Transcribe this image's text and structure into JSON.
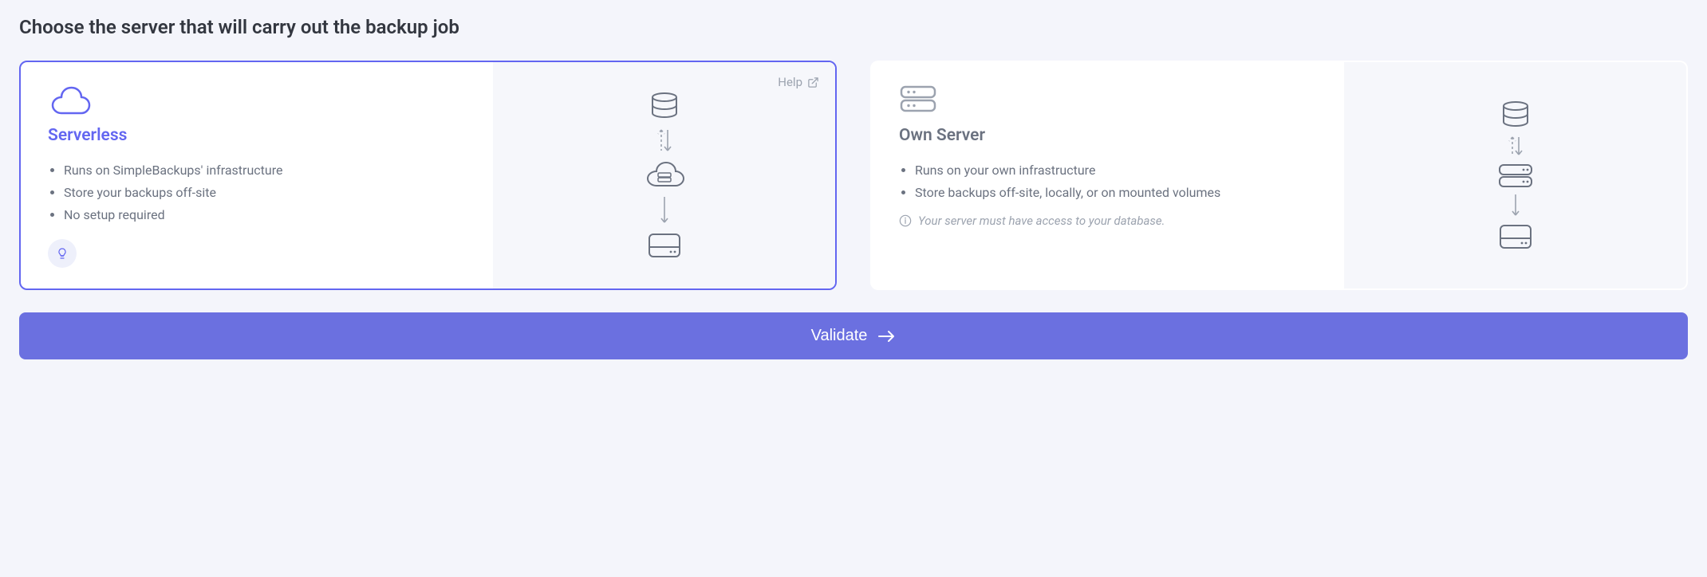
{
  "page": {
    "title": "Choose the server that will carry out the backup job"
  },
  "options": {
    "serverless": {
      "title": "Serverless",
      "features": [
        "Runs on SimpleBackups' infrastructure",
        "Store your backups off-site",
        "No setup required"
      ],
      "help_label": "Help"
    },
    "own_server": {
      "title": "Own Server",
      "features": [
        "Runs on your own infrastructure",
        "Store backups off-site, locally, or on mounted volumes"
      ],
      "note": "Your server must have access to your database."
    }
  },
  "actions": {
    "validate": "Validate"
  },
  "colors": {
    "accent": "#6366f1",
    "button": "#6b70e0",
    "muted": "#9ca3af"
  }
}
